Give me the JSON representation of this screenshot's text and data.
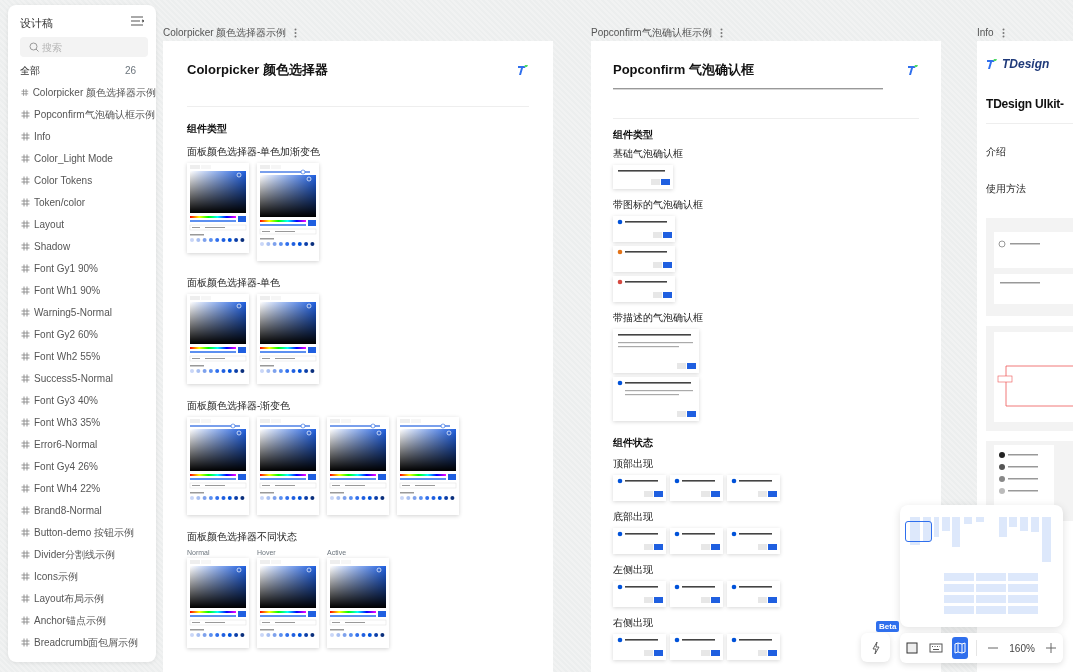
{
  "sidebar": {
    "title": "设计稿",
    "search": {
      "placeholder": "搜索"
    },
    "all": {
      "label": "全部",
      "count": "26"
    },
    "items": [
      {
        "label": "Colorpicker 颜色选择器示例"
      },
      {
        "label": "Popconfirm气泡确认框示例"
      },
      {
        "label": "Info"
      },
      {
        "label": "Color_Light Mode"
      },
      {
        "label": "Color Tokens"
      },
      {
        "label": "Token/color"
      },
      {
        "label": "Layout"
      },
      {
        "label": "Shadow"
      },
      {
        "label": "Font Gy1 90%"
      },
      {
        "label": "Font Wh1 90%"
      },
      {
        "label": "Warning5-Normal"
      },
      {
        "label": "Font Gy2 60%"
      },
      {
        "label": "Font Wh2 55%"
      },
      {
        "label": "Success5-Normal"
      },
      {
        "label": "Font Gy3 40%"
      },
      {
        "label": "Font Wh3 35%"
      },
      {
        "label": "Error6-Normal"
      },
      {
        "label": "Font Gy4 26%"
      },
      {
        "label": "Font Wh4 22%"
      },
      {
        "label": "Brand8-Normal"
      },
      {
        "label": "Button-demo 按钮示例"
      },
      {
        "label": "Divider分割线示例"
      },
      {
        "label": "Icons示例"
      },
      {
        "label": "Layout布局示例"
      },
      {
        "label": "Anchor锚点示例"
      },
      {
        "label": "Breadcrumb面包屑示例"
      }
    ]
  },
  "frames": [
    {
      "kind": "colorpicker",
      "label": "Colorpicker 颜色选择器示例",
      "title": "Colorpicker 颜色选择器",
      "section": "组件类型",
      "groups": [
        {
          "title": "面板颜色选择器-单色加渐变色",
          "pickers": [
            {
              "kind": "solid"
            },
            {
              "kind": "gradient"
            }
          ]
        },
        {
          "title": "面板颜色选择器-单色",
          "pickers": [
            {
              "kind": "solid"
            },
            {
              "kind": "solid"
            }
          ]
        },
        {
          "title": "面板颜色选择器-渐变色",
          "pickers": [
            {
              "kind": "gradient"
            },
            {
              "kind": "gradient"
            },
            {
              "kind": "gradient"
            },
            {
              "kind": "gradient"
            }
          ]
        },
        {
          "title": "面板颜色选择器不同状态",
          "pickers": [
            {
              "kind": "solid",
              "label": "Normal"
            },
            {
              "kind": "solid",
              "label": "Hover"
            },
            {
              "kind": "solid",
              "label": "Active"
            }
          ]
        }
      ]
    },
    {
      "kind": "popconfirm",
      "label": "Popconfirm气泡确认框示例",
      "title": "Popconfirm 气泡确认框",
      "sections": [
        {
          "title": "组件类型",
          "groups": [
            {
              "title": "基础气泡确认框",
              "cards": [
                {
                  "kind": "basic"
                }
              ]
            },
            {
              "title": "带图标的气泡确认框",
              "cards": [
                {
                  "kind": "icon",
                  "color": "#0052d9"
                },
                {
                  "kind": "icon",
                  "color": "#e37318"
                },
                {
                  "kind": "icon",
                  "color": "#d54941"
                }
              ]
            },
            {
              "title": "带描述的气泡确认框",
              "cards": [
                {
                  "kind": "desc"
                },
                {
                  "kind": "desc",
                  "color": "#0052d9"
                }
              ]
            }
          ]
        },
        {
          "title": "组件状态",
          "groups": [
            {
              "title": "顶部出现",
              "cards": [
                {
                  "kind": "state",
                  "color": "#0052d9"
                },
                {
                  "kind": "state",
                  "color": "#0052d9"
                },
                {
                  "kind": "state",
                  "color": "#0052d9"
                }
              ]
            },
            {
              "title": "底部出现",
              "cards": [
                {
                  "kind": "state",
                  "color": "#0052d9"
                },
                {
                  "kind": "state",
                  "color": "#0052d9"
                },
                {
                  "kind": "state",
                  "color": "#0052d9"
                }
              ]
            },
            {
              "title": "左侧出现",
              "cards": [
                {
                  "kind": "state",
                  "color": "#0052d9"
                },
                {
                  "kind": "state",
                  "color": "#0052d9"
                },
                {
                  "kind": "state",
                  "color": "#0052d9"
                }
              ]
            },
            {
              "title": "右侧出现",
              "cards": [
                {
                  "kind": "state",
                  "color": "#0052d9"
                },
                {
                  "kind": "state",
                  "color": "#0052d9"
                },
                {
                  "kind": "state",
                  "color": "#0052d9"
                }
              ]
            }
          ]
        }
      ]
    },
    {
      "kind": "info",
      "label": "Info",
      "logo": "TDesign",
      "title": "TDesign UIkit-",
      "headings": [
        "介绍",
        "使用方法"
      ]
    }
  ],
  "toolbar": {
    "beta": "Beta",
    "views": [
      {
        "kind": "frame",
        "selected": false
      },
      {
        "kind": "keyboard",
        "selected": false
      },
      {
        "kind": "map",
        "selected": true
      }
    ],
    "zoom": "160%"
  }
}
